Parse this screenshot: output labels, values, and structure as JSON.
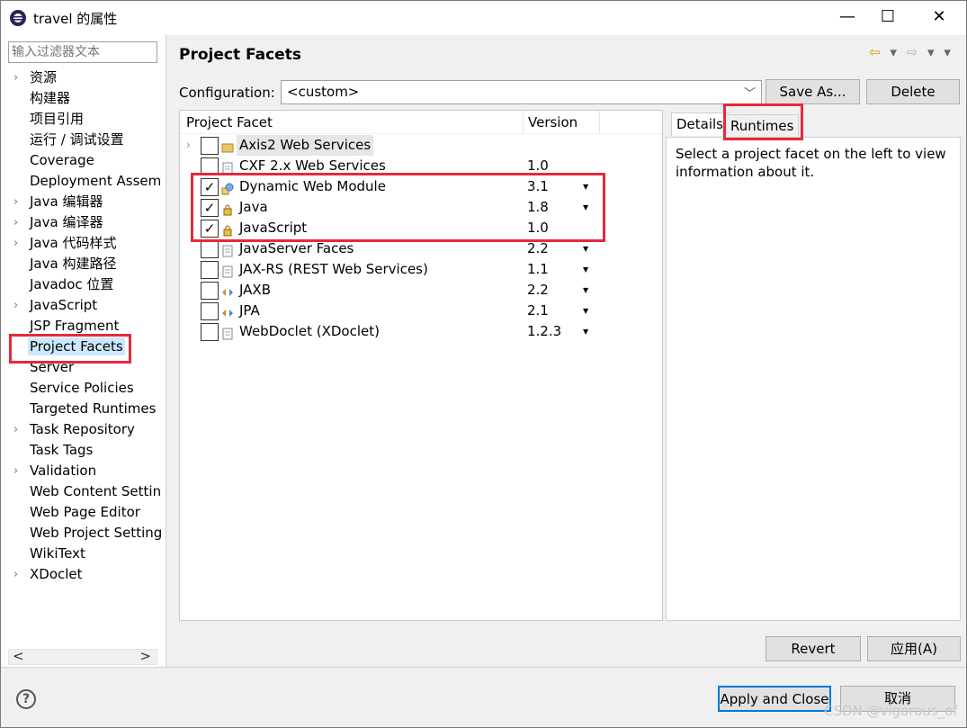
{
  "window": {
    "title": "travel 的属性",
    "min_glyph": "—",
    "max_glyph": "☐",
    "close_glyph": "✕"
  },
  "sidebar": {
    "filter_placeholder": "输入过滤器文本",
    "items": [
      {
        "label": "资源",
        "expandable": true
      },
      {
        "label": "构建器",
        "expandable": false
      },
      {
        "label": "项目引用",
        "expandable": false
      },
      {
        "label": "运行 / 调试设置",
        "expandable": false
      },
      {
        "label": "Coverage",
        "expandable": false
      },
      {
        "label": "Deployment Assem",
        "expandable": false
      },
      {
        "label": "Java 编辑器",
        "expandable": true
      },
      {
        "label": "Java 编译器",
        "expandable": true
      },
      {
        "label": "Java 代码样式",
        "expandable": true
      },
      {
        "label": "Java 构建路径",
        "expandable": false
      },
      {
        "label": "Javadoc 位置",
        "expandable": false
      },
      {
        "label": "JavaScript",
        "expandable": true
      },
      {
        "label": "JSP Fragment",
        "expandable": false
      },
      {
        "label": "Project Facets",
        "expandable": false,
        "selected": true
      },
      {
        "label": "Server",
        "expandable": false
      },
      {
        "label": "Service Policies",
        "expandable": false
      },
      {
        "label": "Targeted Runtimes",
        "expandable": false
      },
      {
        "label": "Task Repository",
        "expandable": true
      },
      {
        "label": "Task Tags",
        "expandable": false
      },
      {
        "label": "Validation",
        "expandable": true
      },
      {
        "label": "Web Content Settin",
        "expandable": false
      },
      {
        "label": "Web Page Editor",
        "expandable": false
      },
      {
        "label": "Web Project Setting",
        "expandable": false
      },
      {
        "label": "WikiText",
        "expandable": false
      },
      {
        "label": "XDoclet",
        "expandable": true
      }
    ],
    "scroll_left": "<",
    "scroll_right": ">"
  },
  "main": {
    "title": "Project Facets",
    "configuration_label": "Configuration:",
    "configuration_value": "<custom>",
    "save_as_label": "Save As...",
    "delete_label": "Delete",
    "facet_column": "Project Facet",
    "version_column": "Version",
    "facets": [
      {
        "name": "Axis2 Web Services",
        "version": "",
        "checked": false,
        "expandable": true,
        "highlighted": true,
        "icon": "folder-icon",
        "has_dropdown": false
      },
      {
        "name": "CXF 2.x Web Services",
        "version": "1.0",
        "checked": false,
        "expandable": false,
        "icon": "document-icon",
        "has_dropdown": false
      },
      {
        "name": "Dynamic Web Module",
        "version": "3.1",
        "checked": true,
        "expandable": false,
        "icon": "web-module-icon",
        "has_dropdown": true
      },
      {
        "name": "Java",
        "version": "1.8",
        "checked": true,
        "expandable": false,
        "icon": "lock-icon",
        "has_dropdown": true
      },
      {
        "name": "JavaScript",
        "version": "1.0",
        "checked": true,
        "expandable": false,
        "icon": "lock-icon",
        "has_dropdown": false
      },
      {
        "name": "JavaServer Faces",
        "version": "2.2",
        "checked": false,
        "expandable": false,
        "icon": "document-icon",
        "has_dropdown": true
      },
      {
        "name": "JAX-RS (REST Web Services)",
        "version": "1.1",
        "checked": false,
        "expandable": false,
        "icon": "document-icon",
        "has_dropdown": true
      },
      {
        "name": "JAXB",
        "version": "2.2",
        "checked": false,
        "expandable": false,
        "icon": "arrows-icon",
        "has_dropdown": true
      },
      {
        "name": "JPA",
        "version": "2.1",
        "checked": false,
        "expandable": false,
        "icon": "arrows-icon",
        "has_dropdown": true
      },
      {
        "name": "WebDoclet (XDoclet)",
        "version": "1.2.3",
        "checked": false,
        "expandable": false,
        "icon": "document-icon",
        "has_dropdown": true
      }
    ],
    "tab_details": "Details",
    "tab_runtimes": "Runtimes",
    "details_text": "Select a project facet on the left to view information about it.",
    "revert_label": "Revert",
    "apply_label": "应用(A)"
  },
  "bottom": {
    "help_glyph": "?",
    "apply_close_label": "Apply and Close",
    "cancel_label": "取消"
  },
  "watermark": "CSDN @vigorous_of",
  "colors": {
    "annotation_red": "#e8283a",
    "selection_blue": "#cce8ff",
    "focus_blue": "#0078d7"
  }
}
